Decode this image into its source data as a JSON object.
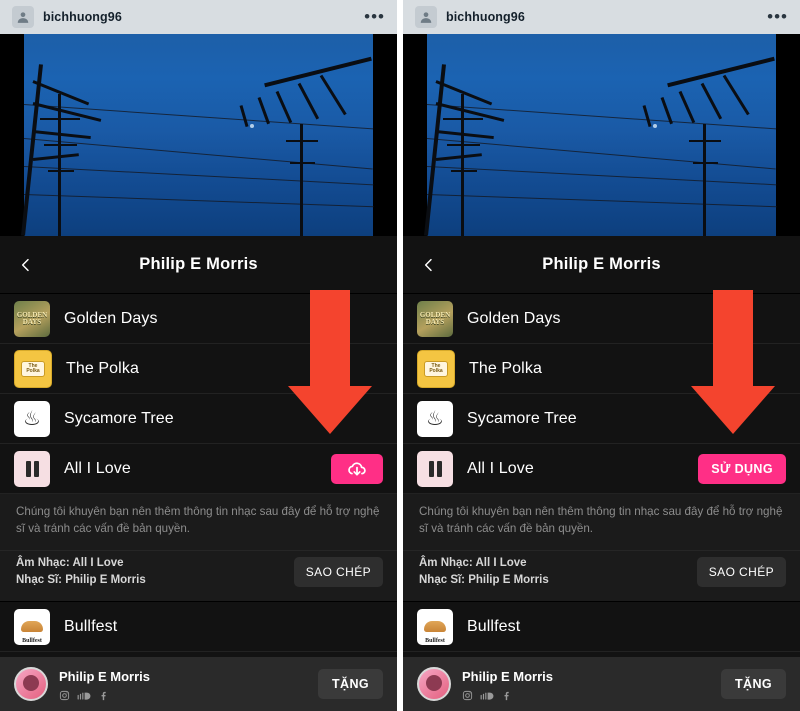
{
  "photo": {
    "username": "bichhuong96",
    "more_icon": "ellipsis-icon",
    "avatar_icon": "profile-avatar-icon"
  },
  "sheet": {
    "back_icon": "back-chevron-icon",
    "title": "Philip E Morris",
    "tracks": [
      {
        "name": "Golden Days",
        "thumb_label": "GOLDEN DAYS"
      },
      {
        "name": "The Polka",
        "thumb_label": "The Polka"
      },
      {
        "name": "Sycamore Tree",
        "thumb_label": "Sycamore Tree"
      },
      {
        "name": "All I Love",
        "thumb_label": "pause-bars"
      },
      {
        "name": "Bullfest",
        "thumb_label": "Bullfest"
      }
    ],
    "note": "Chúng tôi khuyên bạn nên thêm thông tin nhạc sau đây để hỗ trợ nghệ sĩ và tránh các vấn đề bản quyền.",
    "meta_music": "Âm Nhạc: All I Love",
    "meta_artist": "Nhạc Sĩ: Philip E Morris",
    "copy_label": "SAO CHÉP",
    "download_icon": "cloud-download-icon",
    "use_label": "SỬ DỤNG"
  },
  "artist_bar": {
    "name": "Philip E Morris",
    "socials": [
      "instagram-icon",
      "soundcloud-icon",
      "facebook-icon"
    ],
    "donate_label": "TẶNG"
  },
  "annotation": {
    "arrow_icon": "red-down-arrow",
    "arrow_color": "#f4442e"
  },
  "colors": {
    "accent_pink": "#ff2f86",
    "sheet_bg": "#121212",
    "note_bg": "#1b1b1b"
  }
}
